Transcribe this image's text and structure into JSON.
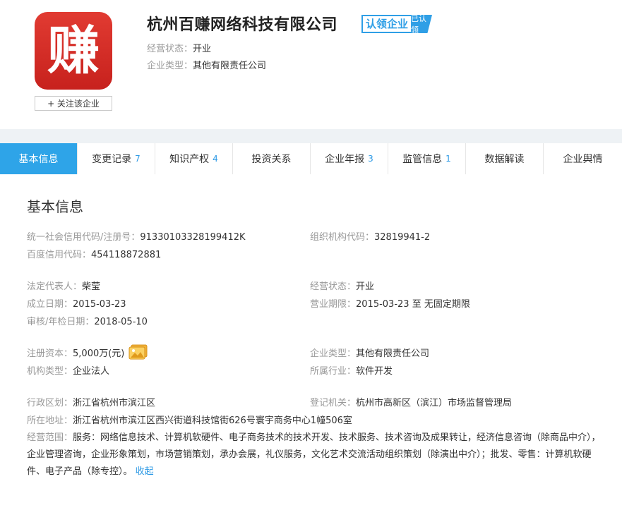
{
  "company": {
    "logo_char": "赚",
    "follow_label": "+ 关注该企业",
    "name": "杭州百赚网络科技有限公司",
    "claim_label": "认领企业",
    "claim_tag": "已认领",
    "status_label": "经营状态：",
    "status_value": "开业",
    "type_label": "企业类型：",
    "type_value": "其他有限责任公司"
  },
  "tabs": [
    {
      "label": "基本信息",
      "count": ""
    },
    {
      "label": "变更记录",
      "count": "7"
    },
    {
      "label": "知识产权",
      "count": "4"
    },
    {
      "label": "投资关系",
      "count": ""
    },
    {
      "label": "企业年报",
      "count": "3"
    },
    {
      "label": "监管信息",
      "count": "1"
    },
    {
      "label": "数据解读",
      "count": ""
    },
    {
      "label": "企业舆情",
      "count": ""
    }
  ],
  "basic": {
    "title": "基本信息",
    "credit_code_label": "统一社会信用代码/注册号：",
    "credit_code_value": "91330103328199412K",
    "org_code_label": "组织机构代码：",
    "org_code_value": "32819941-2",
    "baidu_code_label": "百度信用代码：",
    "baidu_code_value": "454118872881",
    "legal_rep_label": "法定代表人：",
    "legal_rep_value": "柴莹",
    "op_status_label": "经营状态：",
    "op_status_value": "开业",
    "founded_label": "成立日期：",
    "founded_value": "2015-03-23",
    "term_label": "营业期限：",
    "term_value": "2015-03-23 至 无固定期限",
    "audit_label": "审核/年检日期：",
    "audit_value": "2018-05-10",
    "capital_label": "注册资本：",
    "capital_value": "5,000万(元)",
    "ent_type_label": "企业类型：",
    "ent_type_value": "其他有限责任公司",
    "org_type_label": "机构类型：",
    "org_type_value": "企业法人",
    "industry_label": "所属行业：",
    "industry_value": "软件开发",
    "region_label": "行政区划：",
    "region_value": "浙江省杭州市滨江区",
    "authority_label": "登记机关：",
    "authority_value": "杭州市高新区（滨江）市场监督管理局",
    "address_label": "所在地址：",
    "address_value": "浙江省杭州市滨江区西兴街道科技馆街626号寰宇商务中心1幢506室",
    "scope_label": "经营范围：",
    "scope_value": "服务：网络信息技术、计算机软硬件、电子商务技术的技术开发、技术服务、技术咨询及成果转让，经济信息咨询（除商品中介），企业管理咨询，企业形象策划，市场营销策划，承办会展，礼仪服务，文化艺术交流活动组织策划（除演出中介）；批发、零售：计算机软硬件、电子产品（除专控）。",
    "collapse_label": "收起"
  },
  "colors": {
    "accent": "#2ea4e8",
    "logo_red": "#d42a24",
    "label_gray": "#999999"
  },
  "icons": {
    "capital_image": "image-icon"
  }
}
